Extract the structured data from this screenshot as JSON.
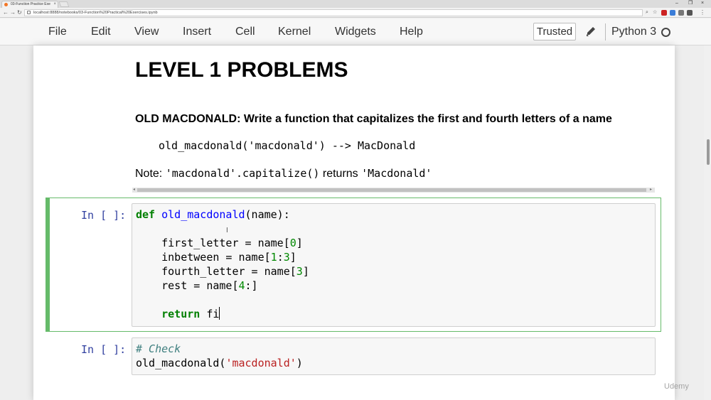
{
  "browser": {
    "tab_title": "03-Function Practice Exe",
    "tab_close": "×",
    "window_controls": [
      "–",
      "❐",
      "×"
    ],
    "url": "localhost:8888/notebooks/03-Function%20Practical%20Exercises.ipynb",
    "extension_colors": [
      "#cc2222",
      "#3b7dd8",
      "#777777",
      "#555555",
      "#777777"
    ]
  },
  "menubar": {
    "items": [
      "File",
      "Edit",
      "View",
      "Insert",
      "Cell",
      "Kernel",
      "Widgets",
      "Help"
    ],
    "trusted_label": "Trusted",
    "kernel_name": "Python 3"
  },
  "markdown": {
    "title": "LEVEL 1 PROBLEMS",
    "problem": "OLD MACDONALD: Write a function that capitalizes the first and fourth letters of a name",
    "example": "old_macdonald('macdonald') --> MacDonald",
    "note_prefix": "Note: ",
    "note_code1": "'macdonald'.capitalize()",
    "note_mid": " returns ",
    "note_code2": "'Macdonald'"
  },
  "cells": [
    {
      "prompt": "In [ ]:",
      "lines": [
        {
          "kw": "def",
          "fn": "old_macdonald",
          "rest": "(name):"
        },
        {
          "text": ""
        },
        {
          "a": "    first_letter = name[",
          "n": "0",
          "b": "]"
        },
        {
          "a": "    inbetween = name[",
          "n": "1",
          "b": ":",
          "n2": "3",
          "c": "]"
        },
        {
          "a": "    fourth_letter = name[",
          "n": "3",
          "b": "]"
        },
        {
          "a": "    rest = name[",
          "n": "4",
          "b": ":]"
        },
        {
          "text": ""
        },
        {
          "indent": "    ",
          "kw": "return",
          "rest": " fi"
        }
      ]
    },
    {
      "prompt": "In [ ]:",
      "comment": "# Check",
      "call_a": "old_macdonald(",
      "call_str": "'macdonald'",
      "call_b": ")"
    }
  ],
  "watermark": "Udemy"
}
